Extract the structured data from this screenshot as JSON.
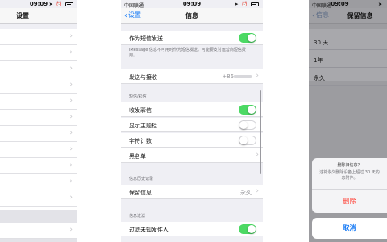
{
  "left": {
    "status": {
      "time": "09:09"
    },
    "nav": {
      "title": "设置"
    }
  },
  "middle": {
    "status": {
      "carrier": "中国联通",
      "time": "09:09"
    },
    "nav": {
      "back_label": "设置",
      "title": "信息"
    },
    "send_as_sms": {
      "label": "作为短信发送",
      "on": true
    },
    "send_as_sms_note": "iMessage 信息不可用时作为短信发送。可能要支付运营商短信费用。",
    "send_receive": {
      "label": "发送与接收",
      "value": "+86"
    },
    "section_sms_mms": "短信/彩信",
    "mms": {
      "label": "收发彩信",
      "on": true
    },
    "subject": {
      "label": "显示主题栏",
      "on": false
    },
    "char_count": {
      "label": "字符计数",
      "on": false
    },
    "blocked": {
      "label": "黑名单"
    },
    "section_history": "信息历史记录",
    "keep_messages": {
      "label": "保留信息",
      "value": "永久"
    },
    "section_filter": "信息过滤",
    "filter_unknown": {
      "label": "过滤未知发件人",
      "on": true
    }
  },
  "right": {
    "status": {
      "carrier": "中国联通",
      "time": "09:09"
    },
    "nav": {
      "back_label": "信息",
      "title": "保留信息"
    },
    "options": [
      "30 天",
      "1年",
      "永久"
    ],
    "sheet": {
      "message_line1": "删除旧信息？",
      "message_line2": "这将永久删除设备上超过 30 天的",
      "message_line3": "息附件。",
      "delete_label": "删除",
      "cancel_label": "取消"
    }
  }
}
